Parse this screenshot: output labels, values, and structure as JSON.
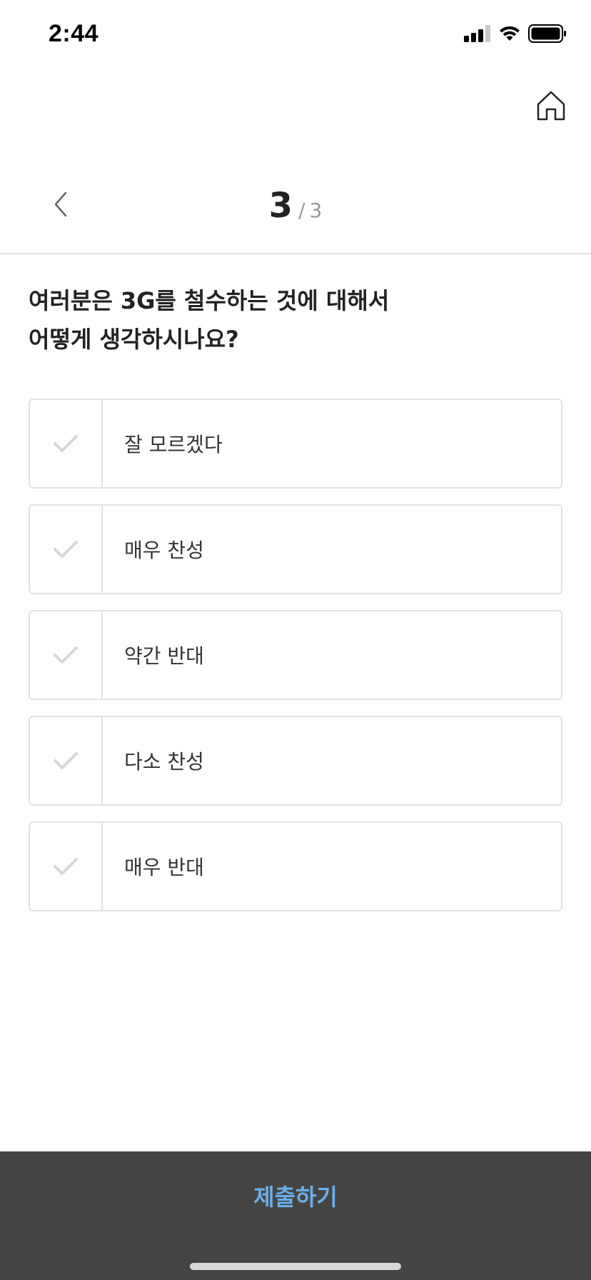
{
  "status_bar": {
    "time": "2:44"
  },
  "header": {
    "home_icon": "home-icon",
    "back_icon": "chevron-left-icon"
  },
  "progress": {
    "current": "3",
    "separator": "/",
    "total": "3"
  },
  "question": {
    "line1": "여러분은 3G를 철수하는 것에 대해서",
    "line2": "어떻게 생각하시나요?"
  },
  "options": [
    {
      "label": "잘 모르겠다",
      "checked": false
    },
    {
      "label": "매우 찬성",
      "checked": false
    },
    {
      "label": "약간 반대",
      "checked": false
    },
    {
      "label": "다소 찬성",
      "checked": false
    },
    {
      "label": "매우 반대",
      "checked": false
    }
  ],
  "footer": {
    "submit_label": "제출하기"
  },
  "colors": {
    "check_inactive": "#d6d6d6",
    "submit_text": "#6aaee8",
    "bottom_bar": "#444444"
  }
}
